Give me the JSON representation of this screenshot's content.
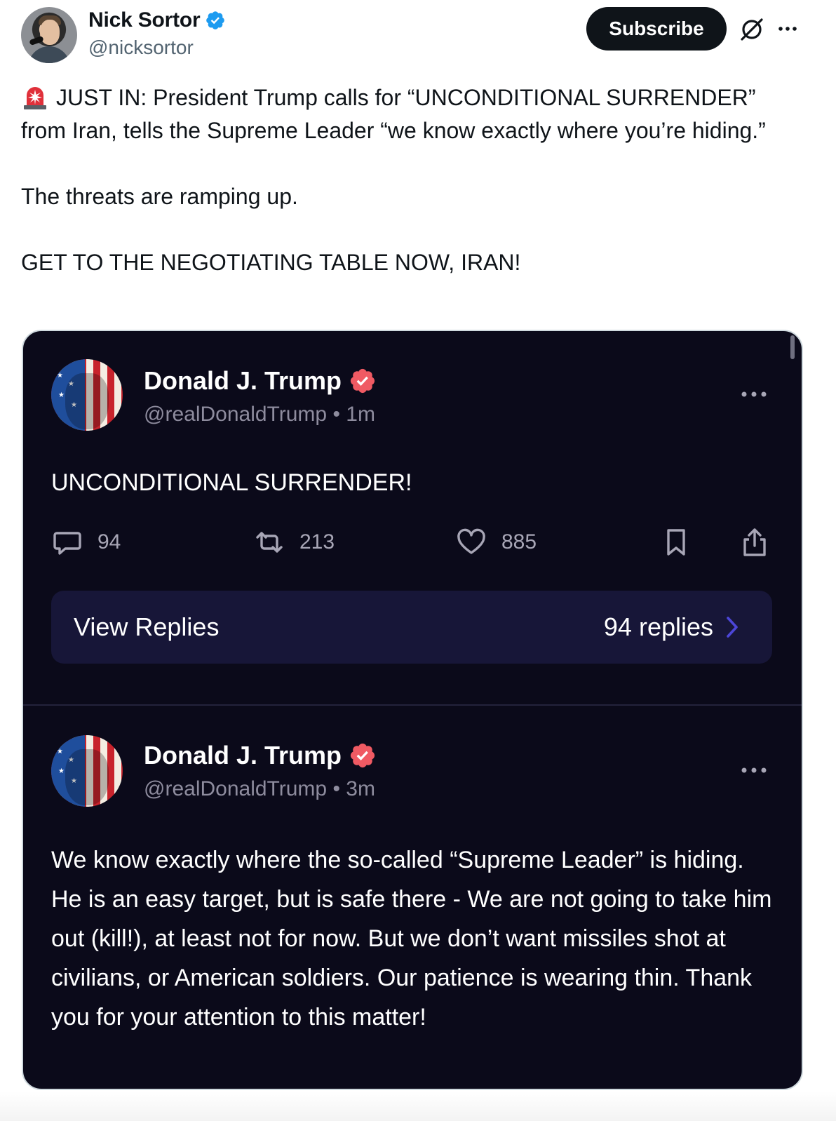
{
  "author": {
    "name": "Nick Sortor",
    "handle": "@nicksortor"
  },
  "header": {
    "subscribe_label": "Subscribe"
  },
  "tweet": {
    "line1": "JUST IN: President Trump calls for “UNCONDITIONAL SURRENDER” from Iran, tells the Supreme Leader “we know exactly where you’re hiding.”",
    "line2": "The threats are ramping up.",
    "line3": "GET TO THE NEGOTIATING TABLE NOW, IRAN!"
  },
  "embed": {
    "post1": {
      "name": "Donald J. Trump",
      "handle": "@realDonaldTrump",
      "time": "1m",
      "text": "UNCONDITIONAL SURRENDER!",
      "replies": "94",
      "reposts": "213",
      "likes": "885",
      "view_replies_label": "View Replies",
      "replies_count_label": "94 replies"
    },
    "post2": {
      "name": "Donald J. Trump",
      "handle": "@realDonaldTrump",
      "time": "3m",
      "text": "We know exactly where the so-called “Supreme Leader” is hiding. He is an easy target, but is safe there - We are not going to take him out (kill!), at least not for now. But we don’t want missiles shot at civilians, or American soldiers. Our patience is wearing thin. Thank you for your attention to this matter!"
    }
  },
  "icons": {
    "verified": "verified-badge-icon",
    "grok": "grok-icon",
    "more": "more-icon",
    "siren": "siren-emoji",
    "reply": "reply-icon",
    "repost": "repost-icon",
    "like": "heart-icon",
    "bookmark": "bookmark-icon",
    "share": "share-icon",
    "chevron": "chevron-right-icon"
  },
  "colors": {
    "verified_blue": "#1d9bf0",
    "truth_badge": "#f05a63",
    "card_bg": "#0b0a1a",
    "view_replies_bg": "#171638"
  }
}
